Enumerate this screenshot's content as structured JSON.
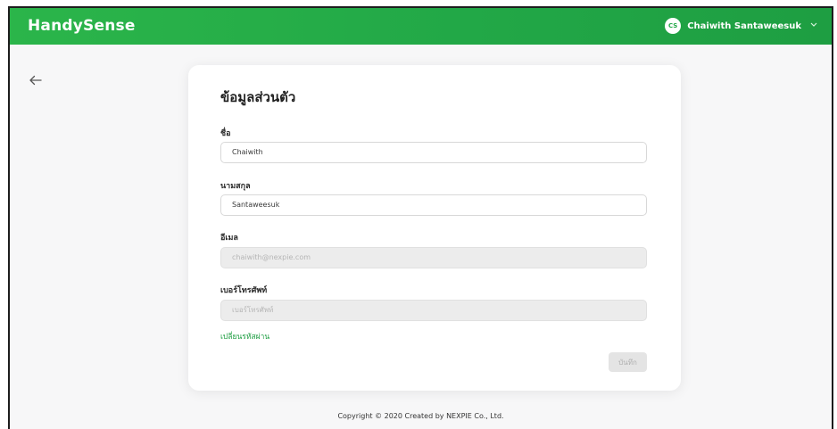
{
  "header": {
    "brand": "HandySense",
    "user_initials": "CS",
    "user_name": "Chaiwith Santaweesuk",
    "accent_color": "#22a847"
  },
  "icons": {
    "back": "arrow-left-icon",
    "dropdown": "chevron-down-icon"
  },
  "profile": {
    "title": "ข้อมูลส่วนตัว",
    "first_name_label": "ชื่อ",
    "first_name_value": "Chaiwith",
    "last_name_label": "นามสกุล",
    "last_name_value": "Santaweesuk",
    "email_label": "อีเมล",
    "email_value": "chaiwith@nexpie.com",
    "phone_label": "เบอร์โทรศัพท์",
    "phone_placeholder": "เบอร์โทรศัพท์",
    "change_password_link": "เปลี่ยนรหัสผ่าน",
    "save_button": "บันทึก"
  },
  "footer": {
    "copyright": "Copyright © 2020 Created by NEXPIE Co., Ltd."
  }
}
